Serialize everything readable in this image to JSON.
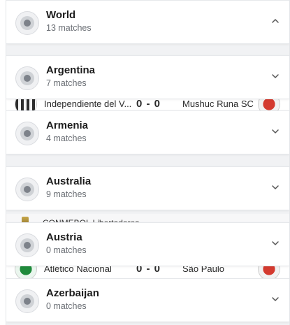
{
  "countries": [
    {
      "name": "World",
      "count": "13 matches",
      "expanded": true
    },
    {
      "name": "Argentina",
      "count": "7 matches",
      "expanded": false
    },
    {
      "name": "Armenia",
      "count": "4 matches",
      "expanded": false
    },
    {
      "name": "Australia",
      "count": "9 matches",
      "expanded": false
    },
    {
      "name": "Austria",
      "count": "0 matches",
      "expanded": false
    },
    {
      "name": "Azerbaijan",
      "count": "0 matches",
      "expanded": false
    }
  ],
  "underlying": {
    "match1": {
      "home": "Independiente del V...",
      "score": "0 - 0",
      "away": "Mushuc Runa SC"
    },
    "league": {
      "title": "CONMEBOL Libertadores"
    },
    "match2": {
      "home": "Atlético Nacional",
      "score": "0 - 0",
      "away": "São Paulo"
    }
  },
  "icons": {
    "globe": "globe-icon",
    "chevron_up": "chevron-up-icon",
    "chevron_down": "chevron-down-icon",
    "crest": "team-crest-icon",
    "trophy": "trophy-icon"
  }
}
